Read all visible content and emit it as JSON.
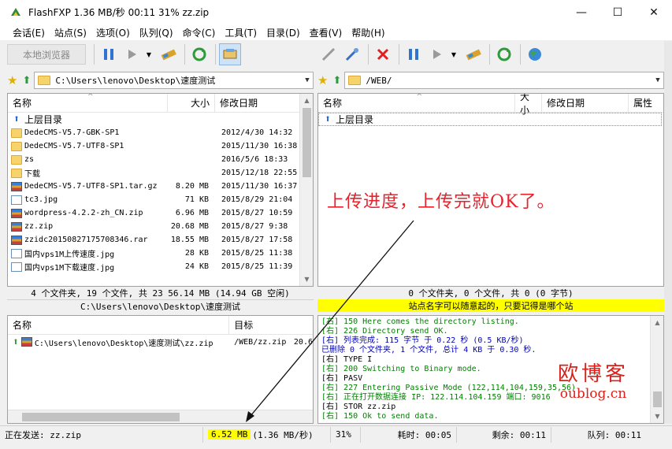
{
  "window": {
    "title": "FlashFXP 1.36 MB/秒 00:11 31% zz.zip",
    "minimize": "—",
    "maximize": "☐",
    "close": "✕"
  },
  "menu": [
    "会话(E)",
    "站点(S)",
    "选项(O)",
    "队列(Q)",
    "命令(C)",
    "工具(T)",
    "目录(D)",
    "查看(V)",
    "帮助(H)"
  ],
  "left_toolbar": {
    "local_browser": "本地浏览器"
  },
  "left_path": "C:\\Users\\lenovo\\Desktop\\速度测试",
  "right_path": "/WEB/",
  "left_panel": {
    "headers": {
      "name": "名称",
      "size": "大小",
      "date": "修改日期"
    },
    "rows": [
      {
        "icon": "up-icon",
        "name": "上层目录",
        "size": "",
        "date": ""
      },
      {
        "icon": "folder-icon",
        "name": "DedeCMS-V5.7-GBK-SP1",
        "size": "",
        "date": "2012/4/30 14:32"
      },
      {
        "icon": "folder-icon",
        "name": "DedeCMS-V5.7-UTF8-SP1",
        "size": "",
        "date": "2015/11/30 16:38"
      },
      {
        "icon": "folder-icon",
        "name": "zs",
        "size": "",
        "date": "2016/5/6 18:33"
      },
      {
        "icon": "folder-icon",
        "name": "下载",
        "size": "",
        "date": "2015/12/18 22:55"
      },
      {
        "icon": "archive-icon",
        "name": "DedeCMS-V5.7-UTF8-SP1.tar.gz",
        "size": "8.20 MB",
        "date": "2015/11/30 16:37"
      },
      {
        "icon": "image-icon",
        "name": "tc3.jpg",
        "size": "71 KB",
        "date": "2015/8/29 21:04"
      },
      {
        "icon": "archive-icon",
        "name": "wordpress-4.2.2-zh_CN.zip",
        "size": "6.96 MB",
        "date": "2015/8/27 10:59"
      },
      {
        "icon": "archive-icon",
        "name": "zz.zip",
        "size": "20.68 MB",
        "date": "2015/8/27 9:38"
      },
      {
        "icon": "archive-icon",
        "name": "zzidc20150827175708346.rar",
        "size": "18.55 MB",
        "date": "2015/8/27 17:58"
      },
      {
        "icon": "image-icon",
        "name": "国内vps1M上传速度.jpg",
        "size": "28 KB",
        "date": "2015/8/25 11:38"
      },
      {
        "icon": "image-icon",
        "name": "国内vps1M下载速度.jpg",
        "size": "24 KB",
        "date": "2015/8/25 11:39"
      }
    ],
    "status": "4 个文件夹, 19 个文件, 共 23 56.14 MB (14.94 GB 空闲)",
    "path_footer": "C:\\Users\\lenovo\\Desktop\\速度测试"
  },
  "right_panel": {
    "headers": {
      "name": "名称",
      "size": "大小",
      "date": "修改日期",
      "attr": "属性"
    },
    "rows": [
      {
        "icon": "up-icon",
        "name": "上层目录"
      }
    ],
    "status": "0 个文件夹, 0 个文件, 共 0 (0 字节)",
    "site_note": "站点名字可以随意起的，只要记得是哪个站"
  },
  "queue": {
    "headers": {
      "name": "名称",
      "target": "目标"
    },
    "rows": [
      {
        "name": "C:\\Users\\lenovo\\Desktop\\速度测试\\zz.zip",
        "target": "/WEB/zz.zip",
        "size": "20.6"
      }
    ]
  },
  "log": [
    {
      "text": "[右] 150 Here comes the directory listing.",
      "color": "green"
    },
    {
      "text": "[右] 226 Directory send OK.",
      "color": "green"
    },
    {
      "text": "[右] 列表完成: 115 字节 于 0.22 秒 (0.5 KB/秒)",
      "color": "blue"
    },
    {
      "text": "已删除 0 个文件夹, 1 个文件, 总计 4 KB 于 0.30 秒.",
      "color": "blue"
    },
    {
      "text": "[右] TYPE I",
      "color": "black"
    },
    {
      "text": "[右] 200 Switching to Binary mode.",
      "color": "green"
    },
    {
      "text": "[右] PASV",
      "color": "black"
    },
    {
      "text": "[右] 227 Entering Passive Mode (122,114,104,159,35,56)",
      "color": "green"
    },
    {
      "text": "[右] 正在打开数据连接 IP: 122.114.104.159 端口: 9016",
      "color": "green"
    },
    {
      "text": "[右] STOR zz.zip",
      "color": "black"
    },
    {
      "text": "[右] 150 Ok to send data.",
      "color": "green"
    }
  ],
  "statusbar": {
    "sending": "正在发送: zz.zip",
    "transferred": "6.52 MB",
    "rate": "(1.36 MB/秒)",
    "percent": "31%",
    "elapsed": "耗时: 00:05",
    "remaining": "剩余: 00:11",
    "queue": "队列: 00:11"
  },
  "annotation": "上传进度，上传完就OK了。",
  "watermark": {
    "big": "欧博客",
    "small": "oublog.cn"
  },
  "colors": {
    "annotation_red": "#e8212a",
    "site_note_bg": "#ffff00",
    "log_green": "#008000",
    "log_blue": "#0000c0"
  }
}
